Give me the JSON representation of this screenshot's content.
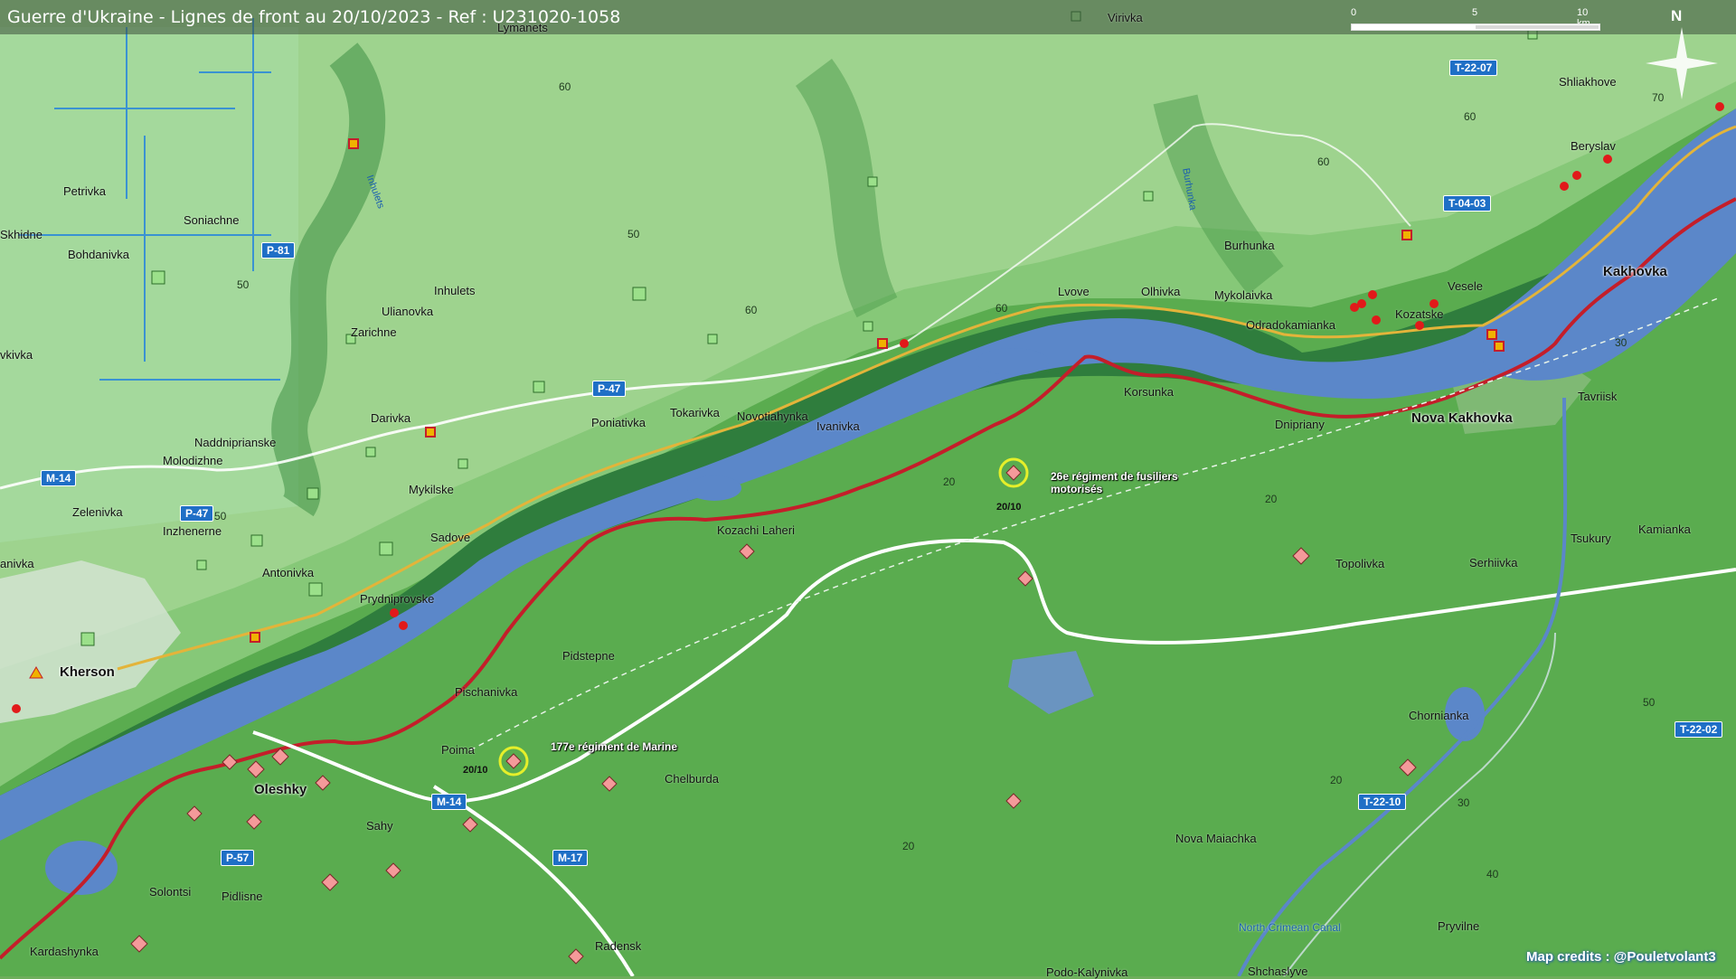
{
  "title": "Guerre d'Ukraine - Lignes de front au 20/10/2023 - Ref : U231020-1058",
  "scale": {
    "labels": [
      "0",
      "5",
      "10 km"
    ]
  },
  "north_label": "N",
  "credits": "Map credits : @Pouletvolant3",
  "colors": {
    "river": "#5b87c9",
    "frontline": "#c41e2a",
    "highland": "#7dc36e",
    "lowland": "#5aac4f",
    "road_label_bg": "#1f6fc6",
    "unit_marker": "#f49a9a"
  },
  "places": {
    "kherson": "Kherson",
    "kakhovka": "Kakhovka",
    "nova_kakhovka": "Nova Kakhovka",
    "beryslav": "Beryslav",
    "oleshky": "Oleshky",
    "petrivka": "Petrivka",
    "soniachne": "Soniachne",
    "bohdanivka": "Bohdanivka",
    "skhidne": "Skhidne",
    "vkivka": "vkivka",
    "ianivka": "anivka",
    "inhulets": "Inhulets",
    "ulianovka": "Ulianovka",
    "zarichne": "Zarichne",
    "darivka": "Darivka",
    "naddniprianske": "Naddniprianske",
    "molodizhne": "Molodizhne",
    "zelenivka": "Zelenivka",
    "inzhenerne": "Inzhenerne",
    "mykilske": "Mykilske",
    "sadove": "Sadove",
    "antonivka": "Antonivka",
    "prydniprovske": "Prydniprovske",
    "poniativka": "Poniativka",
    "tokarivka": "Tokarivka",
    "novotiahynka": "Novotiahynka",
    "ivanivka": "Ivanivka",
    "lvove": "Lvove",
    "olhivka": "Olhivka",
    "mykolaivka": "Mykolaivka",
    "burhunka": "Burhunka",
    "odradokamianka": "Odradokamianka",
    "kozatske": "Kozatske",
    "vesele": "Vesele",
    "shliakhove": "Shliakhove",
    "virivka": "Virivka",
    "lymanets": "Lymanets",
    "korsunka": "Korsunka",
    "dnipriany": "Dnipriany",
    "tavriisk": "Tavriisk",
    "kozachi_laheri": "Kozachi Laheri",
    "pidstepne": "Pidstepne",
    "pischanivka": "Pischanivka",
    "poima": "Poima",
    "chelburda": "Chelburda",
    "sahy": "Sahy",
    "solontsi": "Solontsi",
    "pidlisne": "Pidlisne",
    "kardashynka": "Kardashynka",
    "radensk": "Radensk",
    "podo_kalynivka": "Podo-Kalynivka",
    "topolivka": "Topolivka",
    "serhiivka": "Serhiivka",
    "tsukury": "Tsukury",
    "kamianka": "Kamianka",
    "chornianka": "Chornianka",
    "nova_maiachka": "Nova Maiachka",
    "pryvilne": "Pryvilne",
    "shchasly": "Shchaslyve"
  },
  "rivers": {
    "inhulets": "Inhulets",
    "burhunka": "Burhunka"
  },
  "canal": "North Crimean Canal",
  "roads": {
    "p81": "P-81",
    "p47a": "P-47",
    "p47b": "P-47",
    "m14a": "M-14",
    "m14b": "M-14",
    "m17": "M-17",
    "p57": "P-57",
    "t2207": "T-22-07",
    "t0403": "T-04-03",
    "t2210": "T-22-10",
    "t2202": "T-22-02"
  },
  "contours": {
    "c1": "60",
    "c2": "50",
    "c3": "60",
    "c4": "50",
    "c5": "60",
    "c6": "60",
    "c7": "60",
    "c8": "70",
    "c9": "50",
    "c10": "20",
    "c11": "20",
    "c12": "30",
    "c13": "20",
    "c14": "20",
    "c15": "30",
    "c16": "40",
    "c17": "50"
  },
  "units": {
    "u26": {
      "name": "26e régiment de fusiliers motorisés",
      "date": "20/10"
    },
    "u177": {
      "name": "177e régiment de Marine",
      "date": "20/10"
    }
  }
}
